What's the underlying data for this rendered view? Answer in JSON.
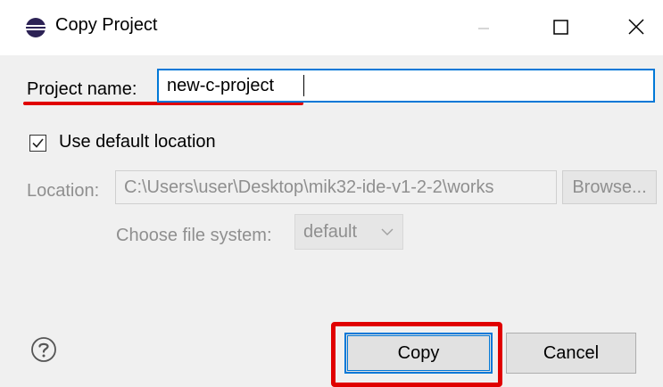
{
  "window": {
    "title": "Copy Project",
    "app_icon": "eclipse-icon",
    "controls": [
      "minimize-icon",
      "maximize-icon",
      "close-icon"
    ]
  },
  "form": {
    "project_name_label": "Project name:",
    "project_name_value": "new-c-project",
    "use_default_location_label": "Use default location",
    "use_default_location_checked": true,
    "location_label": "Location:",
    "location_value": "C:\\Users\\user\\Desktop\\mik32-ide-v1-2-2\\works",
    "browse_label": "Browse...",
    "file_system_label": "Choose file system:",
    "file_system_value": "default"
  },
  "buttons": {
    "help_icon": "question-mark-icon",
    "copy_label": "Copy",
    "cancel_label": "Cancel"
  },
  "colors": {
    "accent": "#0078d7",
    "highlight": "#e00000",
    "disabled_text": "#8f8f8f",
    "dialog_bg": "#f0f0f0"
  }
}
